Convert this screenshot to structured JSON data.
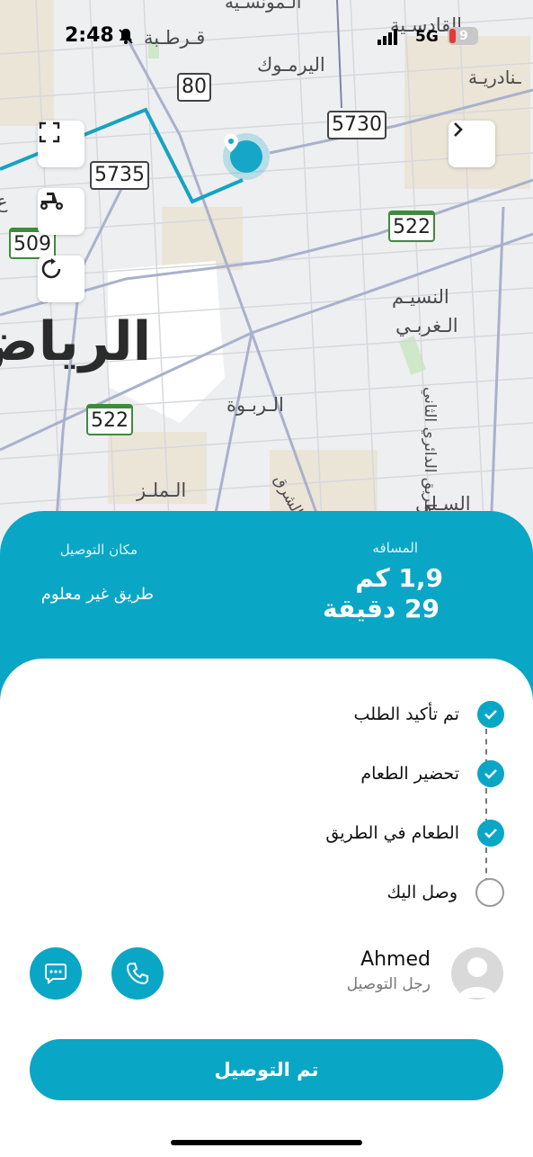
{
  "status_bar": {
    "time": "2:48",
    "network": "5G",
    "battery": "9"
  },
  "map": {
    "labels": {
      "qurtuba": "قـرطـبة",
      "qadisiyah": "القادسـية",
      "yarmouk": "اليرمـوك",
      "andalusiya": "ـنادريـة",
      "naseem": "النسيـم",
      "gharbi": "الـغربـي",
      "riyadh": "الرياض",
      "rabwa": "الـربـوة",
      "malaz": "الـملـز",
      "ring_road": "الطريق الدائري الثاني",
      "sharq": "الشرق",
      "salai": "السـلي",
      "west_letter": "ع",
      "top_cut": "الـمونسـية"
    },
    "shields": {
      "s80": "80",
      "s5730": "5730",
      "s5735": "5735",
      "s522a": "522",
      "s522b": "522",
      "s509": "509"
    }
  },
  "summary": {
    "distance_label": "المسافه",
    "distance_value": "1,9 كم",
    "time_value": "29 دقيقة",
    "delivery_place_label": "مكان التوصيل",
    "delivery_place_value": "طريق غير معلوم"
  },
  "steps": [
    {
      "label": "تم تأكيد الطلب",
      "done": true
    },
    {
      "label": "تحضير الطعام",
      "done": true
    },
    {
      "label": "الطعام في الطريق",
      "done": true
    },
    {
      "label": "وصل اليك",
      "done": false
    }
  ],
  "driver": {
    "name": "Ahmed",
    "role": "رجل التوصيل"
  },
  "cta_label": "تم التوصيل",
  "colors": {
    "accent": "#0aa6c6"
  }
}
